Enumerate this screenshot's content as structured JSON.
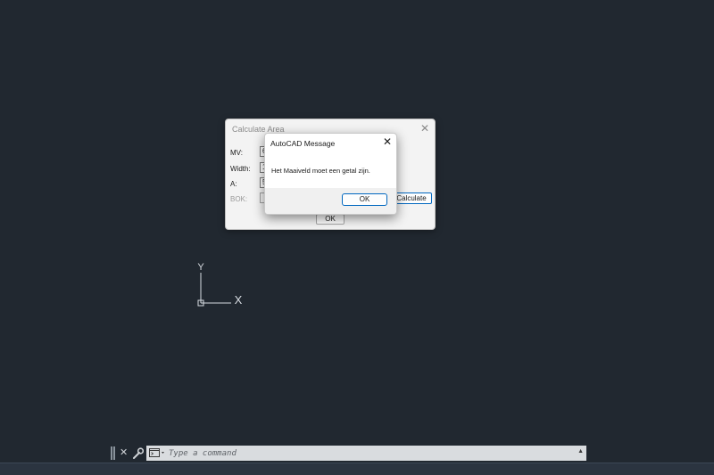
{
  "ucs": {
    "x_label": "X",
    "y_label": "Y"
  },
  "calc_dialog": {
    "title": "Calculate Area",
    "fields": [
      {
        "label": "MV:",
        "value": "6"
      },
      {
        "label": "Width:",
        "value": "1"
      },
      {
        "label": "A:",
        "value": "5"
      }
    ],
    "bok_label": "BOK:",
    "bok_value": "",
    "calculate_label": "Calculate",
    "ok_label": "OK"
  },
  "message_box": {
    "title": "AutoCAD Message",
    "text": "Het Maaiveld moet een getal zijn.",
    "ok_label": "OK"
  },
  "command_line": {
    "placeholder": "Type a command"
  },
  "colors": {
    "canvas": "#212830",
    "accent": "#0067c0"
  }
}
